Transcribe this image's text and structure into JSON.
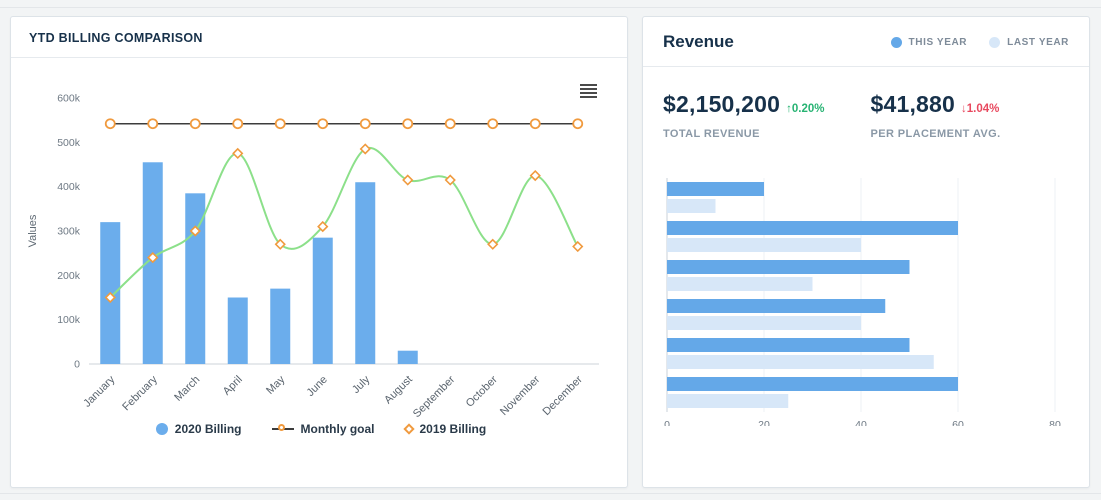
{
  "page": {
    "background": "#f2f4f5"
  },
  "left_card": {
    "title": "YTD BILLING COMPARISON",
    "legend": [
      {
        "label": "2020 Billing",
        "marker": "circle",
        "color": "#6badec"
      },
      {
        "label": "Monthly goal",
        "marker": "line-circle",
        "color": "#f09a3e"
      },
      {
        "label": "2019 Billing",
        "marker": "diamond",
        "color": "#f09a3e"
      }
    ]
  },
  "right_card": {
    "title": "Revenue",
    "legend": [
      {
        "label": "THIS YEAR",
        "color": "#64a8e8"
      },
      {
        "label": "LAST YEAR",
        "color": "#d7e7f8"
      }
    ],
    "stats": [
      {
        "value": "$2,150,200",
        "delta": "↑0.20%",
        "direction": "up",
        "label": "TOTAL REVENUE"
      },
      {
        "value": "$41,880",
        "delta": "↓1.04%",
        "direction": "down",
        "label": "PER PLACEMENT AVG."
      }
    ]
  },
  "colors": {
    "accent_blue": "#64a8e8",
    "light_blue": "#d7e7f8",
    "bar_blue": "#6badec",
    "green_line": "#8ce08a",
    "orange_marker": "#f09a3e",
    "goal_line": "#3c3c3c",
    "positive": "#27b373",
    "negative": "#e8495f",
    "title_text": "#17314a",
    "muted_text": "#8a98a6"
  },
  "chart_data": [
    {
      "type": "combo-bar-line",
      "title": "YTD BILLING COMPARISON",
      "ylabel": "Values",
      "ylim": [
        0,
        600000
      ],
      "yticks": [
        {
          "v": 0,
          "label": "0"
        },
        {
          "v": 100000,
          "label": "100k"
        },
        {
          "v": 200000,
          "label": "200k"
        },
        {
          "v": 300000,
          "label": "300k"
        },
        {
          "v": 400000,
          "label": "400k"
        },
        {
          "v": 500000,
          "label": "500k"
        },
        {
          "v": 600000,
          "label": "600k"
        }
      ],
      "categories": [
        "January",
        "February",
        "March",
        "April",
        "May",
        "June",
        "July",
        "August",
        "September",
        "October",
        "November",
        "December"
      ],
      "series": [
        {
          "name": "2020 Billing",
          "type": "bar",
          "color": "#6badec",
          "values": [
            320000,
            455000,
            385000,
            150000,
            170000,
            285000,
            410000,
            30000,
            0,
            0,
            0,
            0
          ]
        },
        {
          "name": "Monthly goal",
          "type": "line",
          "color": "#3c3c3c",
          "marker": "circle",
          "marker_color": "#f09a3e",
          "values": [
            542000,
            542000,
            542000,
            542000,
            542000,
            542000,
            542000,
            542000,
            542000,
            542000,
            542000,
            542000
          ]
        },
        {
          "name": "2019 Billing",
          "type": "line",
          "color": "#8ce08a",
          "marker": "diamond",
          "marker_color": "#f09a3e",
          "values": [
            150000,
            240000,
            300000,
            475000,
            270000,
            310000,
            485000,
            415000,
            415000,
            270000,
            425000,
            265000
          ]
        }
      ],
      "legend_position": "bottom",
      "grid": false
    },
    {
      "type": "bar-horizontal",
      "title": "Revenue",
      "xlim": [
        0,
        80
      ],
      "xticks": [
        0,
        20,
        40,
        60,
        80
      ],
      "series": [
        {
          "name": "THIS YEAR",
          "color": "#64a8e8",
          "values": [
            20,
            60,
            50,
            45,
            50,
            60
          ]
        },
        {
          "name": "LAST YEAR",
          "color": "#d7e7f8",
          "values": [
            10,
            40,
            30,
            40,
            55,
            25
          ]
        }
      ],
      "legend_position": "top-right",
      "grid": true
    }
  ]
}
